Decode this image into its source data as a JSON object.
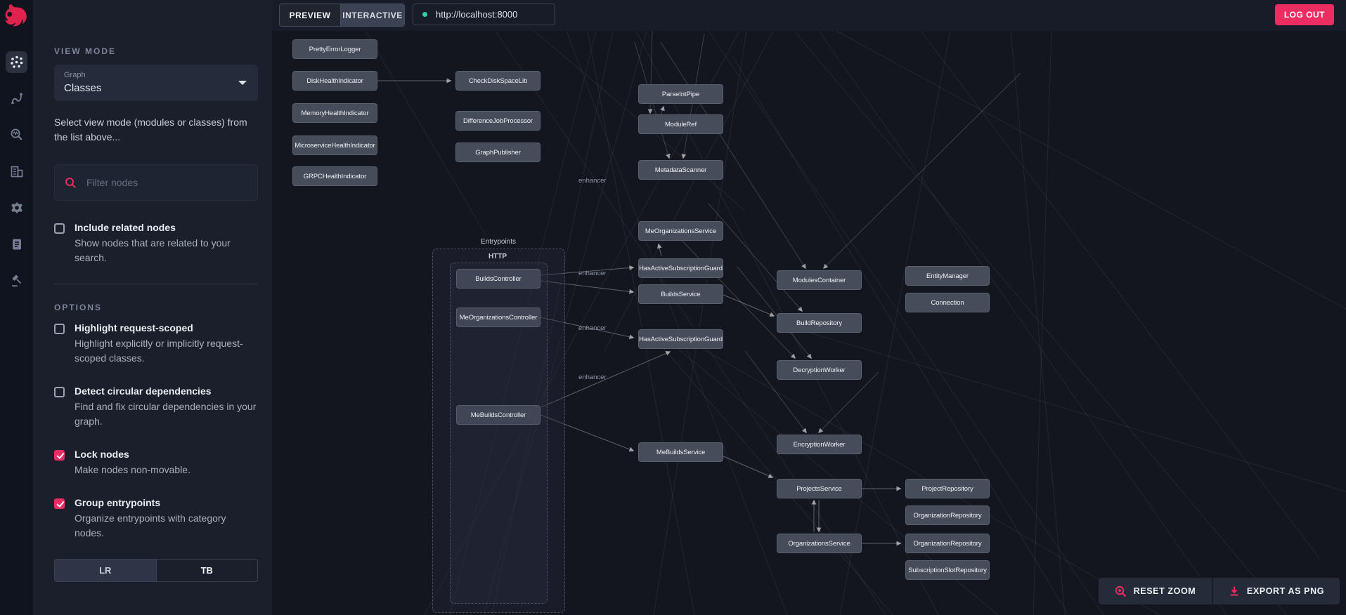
{
  "topbar": {
    "tabs": [
      {
        "label": "PREVIEW",
        "active": false
      },
      {
        "label": "INTERACTIVE",
        "active": true
      }
    ],
    "url": "http://localhost:8000",
    "logout_label": "LOG OUT"
  },
  "rail": {
    "icons": [
      {
        "name": "graph-view-icon",
        "selected": true
      },
      {
        "name": "route-icon",
        "selected": false
      },
      {
        "name": "search-insights-icon",
        "selected": false
      },
      {
        "name": "organization-icon",
        "selected": false
      },
      {
        "name": "settings-icon",
        "selected": false
      },
      {
        "name": "logs-icon",
        "selected": false
      },
      {
        "name": "gavel-icon",
        "selected": false
      }
    ]
  },
  "sidebar": {
    "view_mode": {
      "heading": "VIEW MODE",
      "select_label": "Graph",
      "select_value": "Classes",
      "description": "Select view mode (modules or classes) from the list above..."
    },
    "filter": {
      "placeholder": "Filter nodes"
    },
    "include_related": {
      "label": "Include related nodes",
      "description": "Show nodes that are related to your search.",
      "checked": false
    },
    "options": {
      "heading": "OPTIONS",
      "items": [
        {
          "label": "Highlight request-scoped",
          "description": "Highlight explicitly or implicitly request-scoped classes.",
          "checked": false
        },
        {
          "label": "Detect circular dependencies",
          "description": "Find and fix circular dependencies in your graph.",
          "checked": false
        },
        {
          "label": "Lock nodes",
          "description": "Make nodes non-movable.",
          "checked": true
        },
        {
          "label": "Group entrypoints",
          "description": "Organize entrypoints with category nodes.",
          "checked": true
        }
      ]
    },
    "direction_toggle": {
      "options": [
        "LR",
        "TB"
      ],
      "selected": "LR"
    }
  },
  "graph": {
    "group_label": "Entrypoints",
    "subgroup_label": "HTTP",
    "edge_labels": [
      "enhancer",
      "enhancer",
      "enhancer",
      "enhancer"
    ],
    "nodes": [
      {
        "label": "PrettyErrorLogger"
      },
      {
        "label": "DiskHealthIndicator"
      },
      {
        "label": "MemoryHealthIndicator"
      },
      {
        "label": "MicroserviceHealthIndicator"
      },
      {
        "label": "GRPCHealthIndicator"
      },
      {
        "label": "CheckDiskSpaceLib"
      },
      {
        "label": "DifferenceJobProcessor"
      },
      {
        "label": "GraphPublisher"
      },
      {
        "label": "ParseIntPipe"
      },
      {
        "label": "ModuleRef"
      },
      {
        "label": "MetadataScanner"
      },
      {
        "label": "MeOrganizationsService"
      },
      {
        "label": "HasActiveSubscriptionGuard"
      },
      {
        "label": "BuildsService"
      },
      {
        "label": "HasActiveSubscriptionGuard"
      },
      {
        "label": "MeBuildsService"
      },
      {
        "label": "BuildsController",
        "entry": true
      },
      {
        "label": "MeOrganizationsController",
        "entry": true
      },
      {
        "label": "MeBuildsController",
        "entry": true
      },
      {
        "label": "ModulesContainer"
      },
      {
        "label": "BuildRepository"
      },
      {
        "label": "DecryptionWorker"
      },
      {
        "label": "EncryptionWorker"
      },
      {
        "label": "ProjectsService"
      },
      {
        "label": "OrganizationsService"
      },
      {
        "label": "EntityManager"
      },
      {
        "label": "Connection"
      },
      {
        "label": "ProjectRepository"
      },
      {
        "label": "OrganizationRepository"
      },
      {
        "label": "OrganizationRepository"
      },
      {
        "label": "SubscriptionSlotRepository"
      }
    ]
  },
  "controls": {
    "reset_label": "RESET ZOOM",
    "export_label": "EXPORT AS PNG"
  },
  "colors": {
    "accent": "#ec2d61",
    "status_dot": "#2bd0a4",
    "node_fill": "#474c5b",
    "sidebar_bg": "#1b1f2b",
    "canvas_bg": "#14161f"
  }
}
